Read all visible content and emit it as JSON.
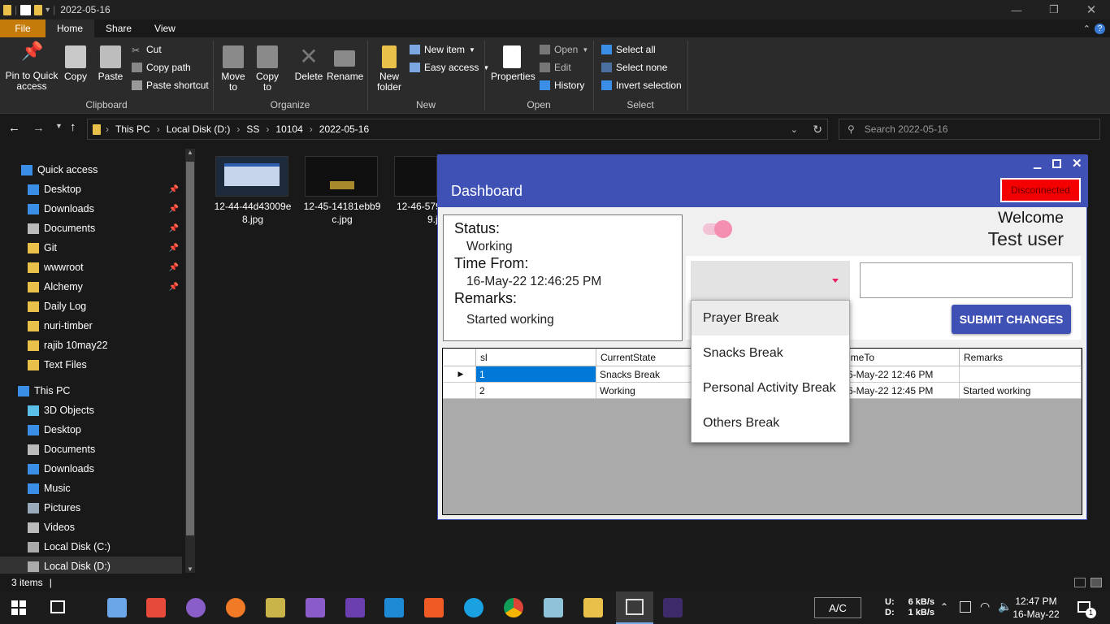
{
  "explorer": {
    "title": "2022-05-16",
    "tabs": [
      "File",
      "Home",
      "Share",
      "View"
    ],
    "ribbon": {
      "pin": "Pin to Quick access",
      "copy": "Copy",
      "paste": "Paste",
      "cut": "Cut",
      "copy_path": "Copy path",
      "paste_shortcut": "Paste shortcut",
      "move_to": "Move to",
      "copy_to": "Copy to",
      "delete": "Delete",
      "rename": "Rename",
      "new_folder": "New folder",
      "new_item": "New item",
      "easy_access": "Easy access",
      "properties": "Properties",
      "open": "Open",
      "edit": "Edit",
      "history": "History",
      "select_all": "Select all",
      "select_none": "Select none",
      "invert_selection": "Invert selection",
      "groups": [
        "Clipboard",
        "Organize",
        "New",
        "Open",
        "Select"
      ]
    },
    "breadcrumb": [
      "This PC",
      "Local Disk (D:)",
      "SS",
      "10104",
      "2022-05-16"
    ],
    "search_placeholder": "Search 2022-05-16",
    "sidebar": [
      {
        "label": "Quick access",
        "icon": "star-icon"
      },
      {
        "label": "Desktop",
        "icon": "desktop-icon"
      },
      {
        "label": "Downloads",
        "icon": "download-icon"
      },
      {
        "label": "Documents",
        "icon": "documents-icon"
      },
      {
        "label": "Git",
        "icon": "folder-icon"
      },
      {
        "label": "wwwroot",
        "icon": "folder-icon"
      },
      {
        "label": "Alchemy",
        "icon": "folder-icon"
      },
      {
        "label": "Daily Log",
        "icon": "folder-icon"
      },
      {
        "label": "nuri-timber",
        "icon": "folder-icon"
      },
      {
        "label": "rajib 10may22",
        "icon": "folder-icon"
      },
      {
        "label": "Text Files",
        "icon": "folder-icon"
      },
      {
        "label": "This PC",
        "icon": "pc-icon"
      },
      {
        "label": "3D Objects",
        "icon": "cube-icon"
      },
      {
        "label": "Desktop",
        "icon": "desktop-icon"
      },
      {
        "label": "Documents",
        "icon": "documents-icon"
      },
      {
        "label": "Downloads",
        "icon": "download-icon"
      },
      {
        "label": "Music",
        "icon": "music-icon"
      },
      {
        "label": "Pictures",
        "icon": "pictures-icon"
      },
      {
        "label": "Videos",
        "icon": "videos-icon"
      },
      {
        "label": "Local Disk (C:)",
        "icon": "disk-icon"
      },
      {
        "label": "Local Disk (D:)",
        "icon": "disk-icon"
      }
    ],
    "files": [
      {
        "line1": "12-44-44d43009e",
        "line2": "8.jpg"
      },
      {
        "line1": "12-45-14181ebb9",
        "line2": "c.jpg"
      },
      {
        "line1": "12-46-579",
        "line2": "9.jp"
      }
    ],
    "status": "3 items"
  },
  "dashboard": {
    "title": "Dashboard",
    "connection": "Disconnected",
    "status_label": "Status:",
    "status_value": "Working",
    "time_from_label": "Time From:",
    "time_from_value": "16-May-22 12:46:25 PM",
    "remarks_label": "Remarks:",
    "remarks_value": "Started working",
    "welcome": "Welcome",
    "user": "Test user",
    "submit": "SUBMIT CHANGES",
    "options": [
      "Prayer Break",
      "Snacks Break",
      "Personal Activity Break",
      "Others Break"
    ],
    "columns": [
      "sl",
      "CurrentState",
      "imeTo",
      "Remarks"
    ],
    "rows": [
      {
        "sl": "1",
        "state": "Snacks Break",
        "time_to": "6-May-22 12:46 PM",
        "remarks": ""
      },
      {
        "sl": "2",
        "state": "Working",
        "time_to": "6-May-22 12:45 PM",
        "remarks": "Started working"
      }
    ]
  },
  "taskbar": {
    "ac": "A/C",
    "net_up_label": "U:",
    "net_down_label": "D:",
    "net_up": "6 kB/s",
    "net_down": "1 kB/s",
    "time": "12:47 PM",
    "date": "16-May-22",
    "notifications": "1"
  }
}
